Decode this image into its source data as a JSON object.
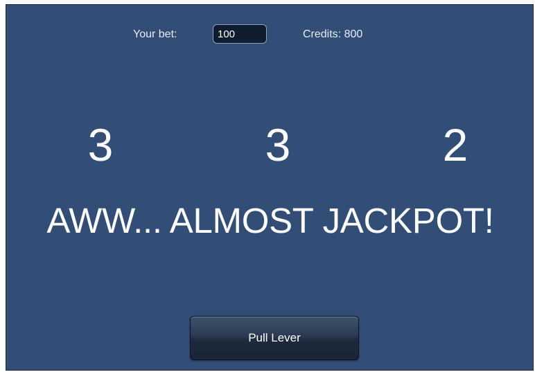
{
  "bet": {
    "label": "Your bet:",
    "value": "100"
  },
  "credits": {
    "text": "Credits: 800"
  },
  "reels": [
    "3",
    "3",
    "2"
  ],
  "message": "AWW... ALMOST JACKPOT!",
  "lever": {
    "label": "Pull Lever"
  },
  "colors": {
    "background": "#324d76",
    "text": "#ffffff",
    "input_background": "#0f1c30"
  }
}
